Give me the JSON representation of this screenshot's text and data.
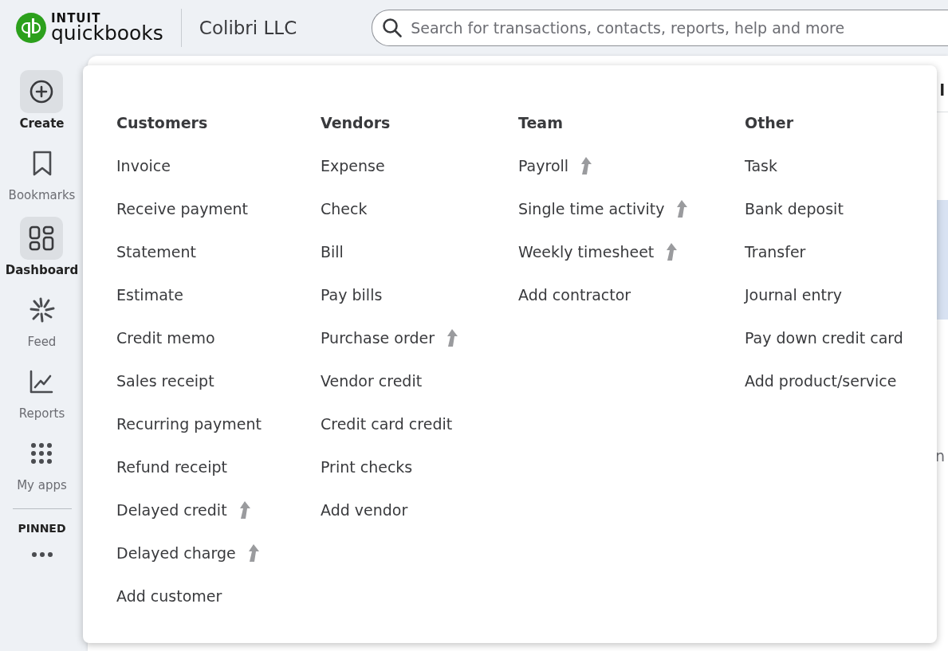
{
  "header": {
    "logo_top": "INTUIT",
    "logo_bottom": "quickbooks",
    "company": "Colibri LLC",
    "search": {
      "placeholder": "Search for transactions, contacts, reports, help and more"
    }
  },
  "sidebar": {
    "items": [
      {
        "label": "Create",
        "highlighted": true
      },
      {
        "label": "Bookmarks",
        "highlighted": false
      },
      {
        "label": "Dashboard",
        "highlighted": true
      },
      {
        "label": "Feed",
        "highlighted": false
      },
      {
        "label": "Reports",
        "highlighted": false
      },
      {
        "label": "My apps",
        "highlighted": false
      }
    ],
    "pinned_label": "PINNED"
  },
  "background": {
    "fragment_top": "l",
    "fragment_middle": "n"
  },
  "create_menu": {
    "columns": [
      {
        "heading": "Customers",
        "items": [
          {
            "label": "Invoice",
            "upgrade": false
          },
          {
            "label": "Receive payment",
            "upgrade": false
          },
          {
            "label": "Statement",
            "upgrade": false
          },
          {
            "label": "Estimate",
            "upgrade": false
          },
          {
            "label": "Credit memo",
            "upgrade": false
          },
          {
            "label": "Sales receipt",
            "upgrade": false
          },
          {
            "label": "Recurring payment",
            "upgrade": false
          },
          {
            "label": "Refund receipt",
            "upgrade": false
          },
          {
            "label": "Delayed credit",
            "upgrade": true
          },
          {
            "label": "Delayed charge",
            "upgrade": true
          },
          {
            "label": "Add customer",
            "upgrade": false
          }
        ]
      },
      {
        "heading": "Vendors",
        "items": [
          {
            "label": "Expense",
            "upgrade": false
          },
          {
            "label": "Check",
            "upgrade": false
          },
          {
            "label": "Bill",
            "upgrade": false
          },
          {
            "label": "Pay bills",
            "upgrade": false
          },
          {
            "label": "Purchase order",
            "upgrade": true
          },
          {
            "label": "Vendor credit",
            "upgrade": false
          },
          {
            "label": "Credit card credit",
            "upgrade": false
          },
          {
            "label": "Print checks",
            "upgrade": false
          },
          {
            "label": "Add vendor",
            "upgrade": false
          }
        ]
      },
      {
        "heading": "Team",
        "items": [
          {
            "label": "Payroll",
            "upgrade": true
          },
          {
            "label": "Single time activity",
            "upgrade": true
          },
          {
            "label": "Weekly timesheet",
            "upgrade": true
          },
          {
            "label": "Add contractor",
            "upgrade": false
          }
        ]
      },
      {
        "heading": "Other",
        "items": [
          {
            "label": "Task",
            "upgrade": false
          },
          {
            "label": "Bank deposit",
            "upgrade": false
          },
          {
            "label": "Transfer",
            "upgrade": false
          },
          {
            "label": "Journal entry",
            "upgrade": false
          },
          {
            "label": "Pay down credit card",
            "upgrade": false
          },
          {
            "label": "Add product/service",
            "upgrade": false
          }
        ]
      }
    ]
  }
}
